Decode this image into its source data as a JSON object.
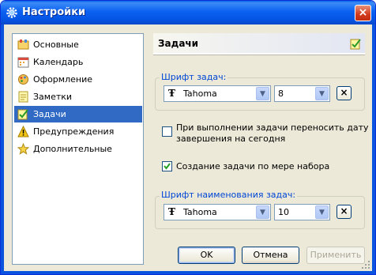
{
  "window": {
    "title": "Настройки",
    "close_label": "×"
  },
  "sidebar": {
    "items": [
      {
        "label": "Основные",
        "icon": "general-icon"
      },
      {
        "label": "Календарь",
        "icon": "calendar-icon"
      },
      {
        "label": "Оформление",
        "icon": "appearance-icon"
      },
      {
        "label": "Заметки",
        "icon": "notes-icon"
      },
      {
        "label": "Задачи",
        "icon": "tasks-icon",
        "selected": true
      },
      {
        "label": "Предупреждения",
        "icon": "warning-icon"
      },
      {
        "label": "Дополнительные",
        "icon": "star-icon"
      }
    ],
    "selected_color": "#316ac5"
  },
  "panel": {
    "title": "Задачи",
    "task_font": {
      "label": "Шрифт задач:",
      "font_value": "Tahoma",
      "size_value": "8",
      "clear_label": "×"
    },
    "move_due_date": {
      "label_line1": "При выполнении задачи переносить дату",
      "label_line2": "завершения на сегодня",
      "checked": false
    },
    "create_while_typing": {
      "label": "Создание задачи по мере набора",
      "checked": true
    },
    "task_name_font": {
      "label": "Шрифт наименования задач:",
      "font_value": "Tahoma",
      "size_value": "10",
      "clear_label": "×"
    }
  },
  "buttons": {
    "ok": "OK",
    "cancel": "Отмена",
    "apply": "Применить"
  }
}
